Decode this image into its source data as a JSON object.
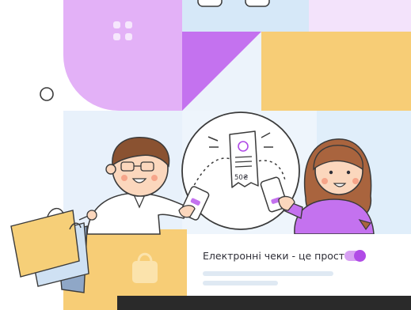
{
  "promo": {
    "receipt_amount": "50₴",
    "card_title": "Електронні чеки - це просто",
    "toggle_on": true
  },
  "colors": {
    "lilac": "#e3b1f7",
    "purple": "#c472ef",
    "yellow": "#f7cd76",
    "light_blue": "#d6e8f8",
    "pale_blue": "#e8f1fb",
    "accent": "#b04be6",
    "dark_bar": "#2a2a2a"
  },
  "icons": [
    "grid-dots-icon",
    "shopping-bag-icon",
    "circle-outline-icon",
    "check-circle-icon"
  ]
}
